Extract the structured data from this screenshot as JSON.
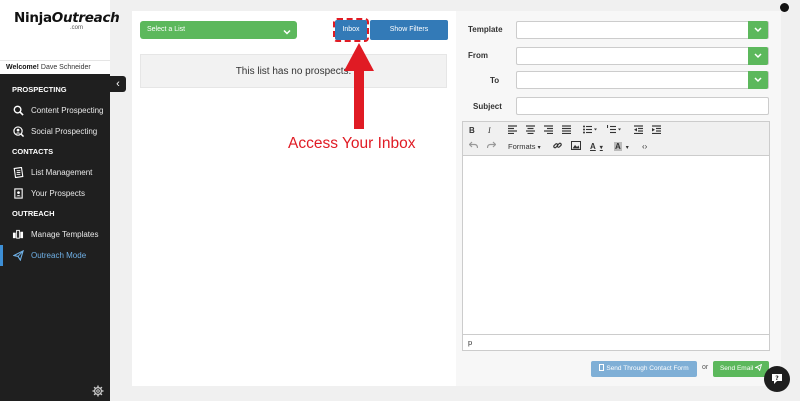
{
  "brand": {
    "name_part1": "Ninja",
    "name_part2": "Outreach",
    "subtitle": ".com"
  },
  "sidebar": {
    "welcome_prefix": "Welcome!",
    "user_name": "Dave Schneider",
    "collapse_glyph": "‹",
    "sections": [
      {
        "title": "PROSPECTING"
      },
      {
        "title": "CONTACTS"
      },
      {
        "title": "OUTREACH"
      }
    ],
    "items": [
      {
        "label": "Content Prospecting",
        "icon": "search-icon"
      },
      {
        "label": "Social Prospecting",
        "icon": "person-search-icon"
      },
      {
        "label": "List Management",
        "icon": "list-icon"
      },
      {
        "label": "Your Prospects",
        "icon": "contact-card-icon"
      },
      {
        "label": "Manage Templates",
        "icon": "templates-icon"
      },
      {
        "label": "Outreach Mode",
        "icon": "paper-plane-icon",
        "active": true
      }
    ]
  },
  "list_panel": {
    "select_placeholder": "Select a List",
    "inbox_label": "Inbox",
    "filters_label": "Show Filters",
    "empty_message": "This list has no prospects."
  },
  "annotation": {
    "text": "Access Your Inbox",
    "color": "#e01b24"
  },
  "compose": {
    "template_label": "Template",
    "from_label": "From",
    "to_label": "To",
    "subject_label": "Subject",
    "formats_label": "Formats",
    "status_path": "p",
    "contact_form_label": "Send Through Contact Form",
    "or_text": "or",
    "send_label": "Send Email"
  },
  "colors": {
    "green": "#5cb85c",
    "blue": "#337ab7",
    "sidebar": "#1f1f1f",
    "active": "#6fb0e6"
  }
}
